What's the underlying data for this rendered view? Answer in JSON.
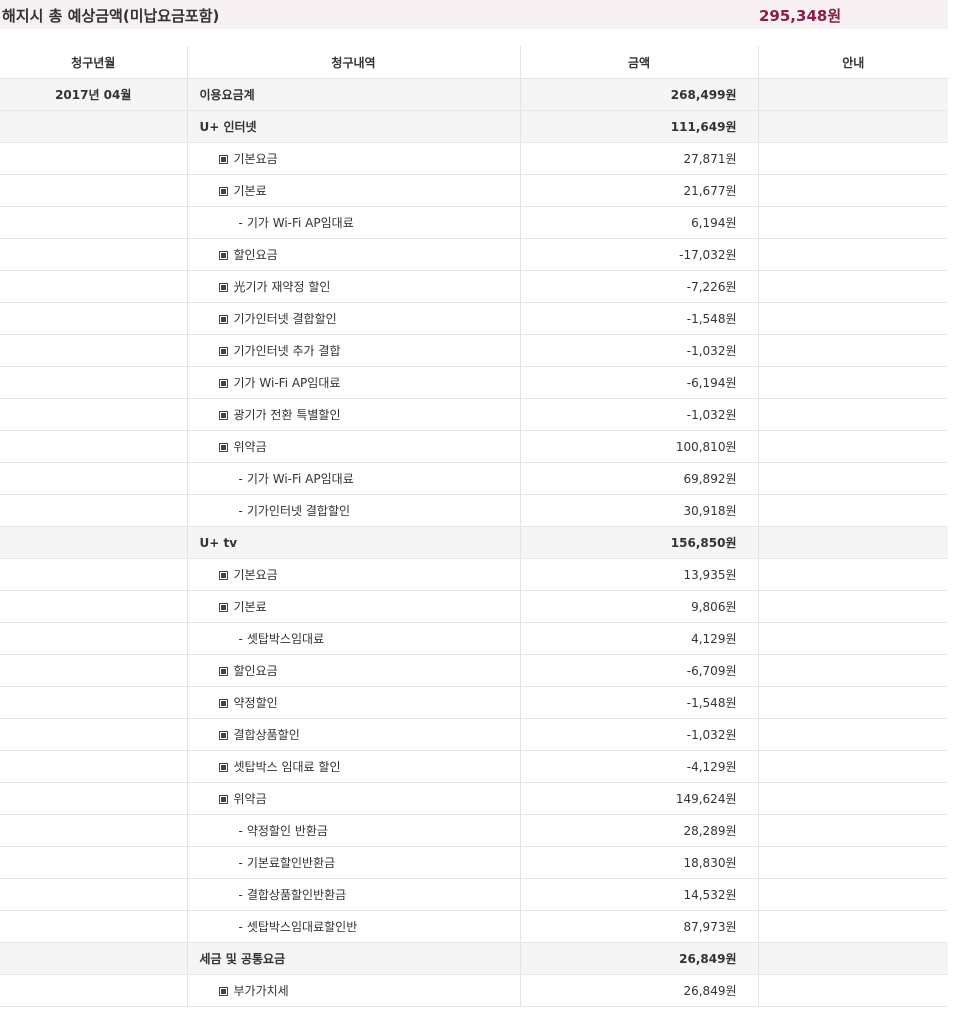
{
  "summary": {
    "label": "해지시 총 예상금액(미납요금포함)",
    "amount": "295,348원",
    "accent_color": "#8a1d4a"
  },
  "table": {
    "headers": {
      "month": "청구년월",
      "item": "청구내역",
      "amount": "금액",
      "note": "안내"
    },
    "bullet_icon": "filled-square-icon",
    "rows": [
      {
        "month": "2017년 04월",
        "level": "group",
        "item": "이용요금계",
        "amount": "268,499원"
      },
      {
        "month": "",
        "level": "group",
        "item": "U+ 인터넷",
        "amount": "111,649원"
      },
      {
        "month": "",
        "level": "sub",
        "item": "기본요금",
        "amount": "27,871원"
      },
      {
        "month": "",
        "level": "sub",
        "item": "기본료",
        "amount": "21,677원"
      },
      {
        "month": "",
        "level": "subsub",
        "item": "기가 Wi-Fi AP임대료",
        "amount": "6,194원"
      },
      {
        "month": "",
        "level": "sub",
        "item": "할인요금",
        "amount": "-17,032원"
      },
      {
        "month": "",
        "level": "sub",
        "item": "光기가 재약정 할인",
        "amount": "-7,226원"
      },
      {
        "month": "",
        "level": "sub",
        "item": "기가인터넷 결합할인",
        "amount": "-1,548원"
      },
      {
        "month": "",
        "level": "sub",
        "item": "기가인터넷 추가 결합",
        "amount": "-1,032원"
      },
      {
        "month": "",
        "level": "sub",
        "item": "기가 Wi-Fi AP임대료",
        "amount": "-6,194원"
      },
      {
        "month": "",
        "level": "sub",
        "item": "광기가 전환 특별할인",
        "amount": "-1,032원"
      },
      {
        "month": "",
        "level": "sub",
        "item": "위약금",
        "amount": "100,810원"
      },
      {
        "month": "",
        "level": "subsub",
        "item": "기가 Wi-Fi AP임대료",
        "amount": "69,892원"
      },
      {
        "month": "",
        "level": "subsub",
        "item": "기가인터넷 결합할인",
        "amount": "30,918원"
      },
      {
        "month": "",
        "level": "group",
        "item": "U+ tv",
        "amount": "156,850원"
      },
      {
        "month": "",
        "level": "sub",
        "item": "기본요금",
        "amount": "13,935원"
      },
      {
        "month": "",
        "level": "sub",
        "item": "기본료",
        "amount": "9,806원"
      },
      {
        "month": "",
        "level": "subsub",
        "item": "셋탑박스임대료",
        "amount": "4,129원"
      },
      {
        "month": "",
        "level": "sub",
        "item": "할인요금",
        "amount": "-6,709원"
      },
      {
        "month": "",
        "level": "sub",
        "item": "약정할인",
        "amount": "-1,548원"
      },
      {
        "month": "",
        "level": "sub",
        "item": "결합상품할인",
        "amount": "-1,032원"
      },
      {
        "month": "",
        "level": "sub",
        "item": "셋탑박스 임대료 할인",
        "amount": "-4,129원"
      },
      {
        "month": "",
        "level": "sub",
        "item": "위약금",
        "amount": "149,624원"
      },
      {
        "month": "",
        "level": "subsub",
        "item": "약정할인 반환금",
        "amount": "28,289원"
      },
      {
        "month": "",
        "level": "subsub",
        "item": "기본료할인반환금",
        "amount": "18,830원"
      },
      {
        "month": "",
        "level": "subsub",
        "item": "결합상품할인반환금",
        "amount": "14,532원"
      },
      {
        "month": "",
        "level": "subsub",
        "item": "셋탑박스임대료할인반",
        "amount": "87,973원"
      },
      {
        "month": "",
        "level": "group",
        "item": "세금 및 공통요금",
        "amount": "26,849원"
      },
      {
        "month": "",
        "level": "sub",
        "item": "부가가치세",
        "amount": "26,849원"
      }
    ]
  }
}
